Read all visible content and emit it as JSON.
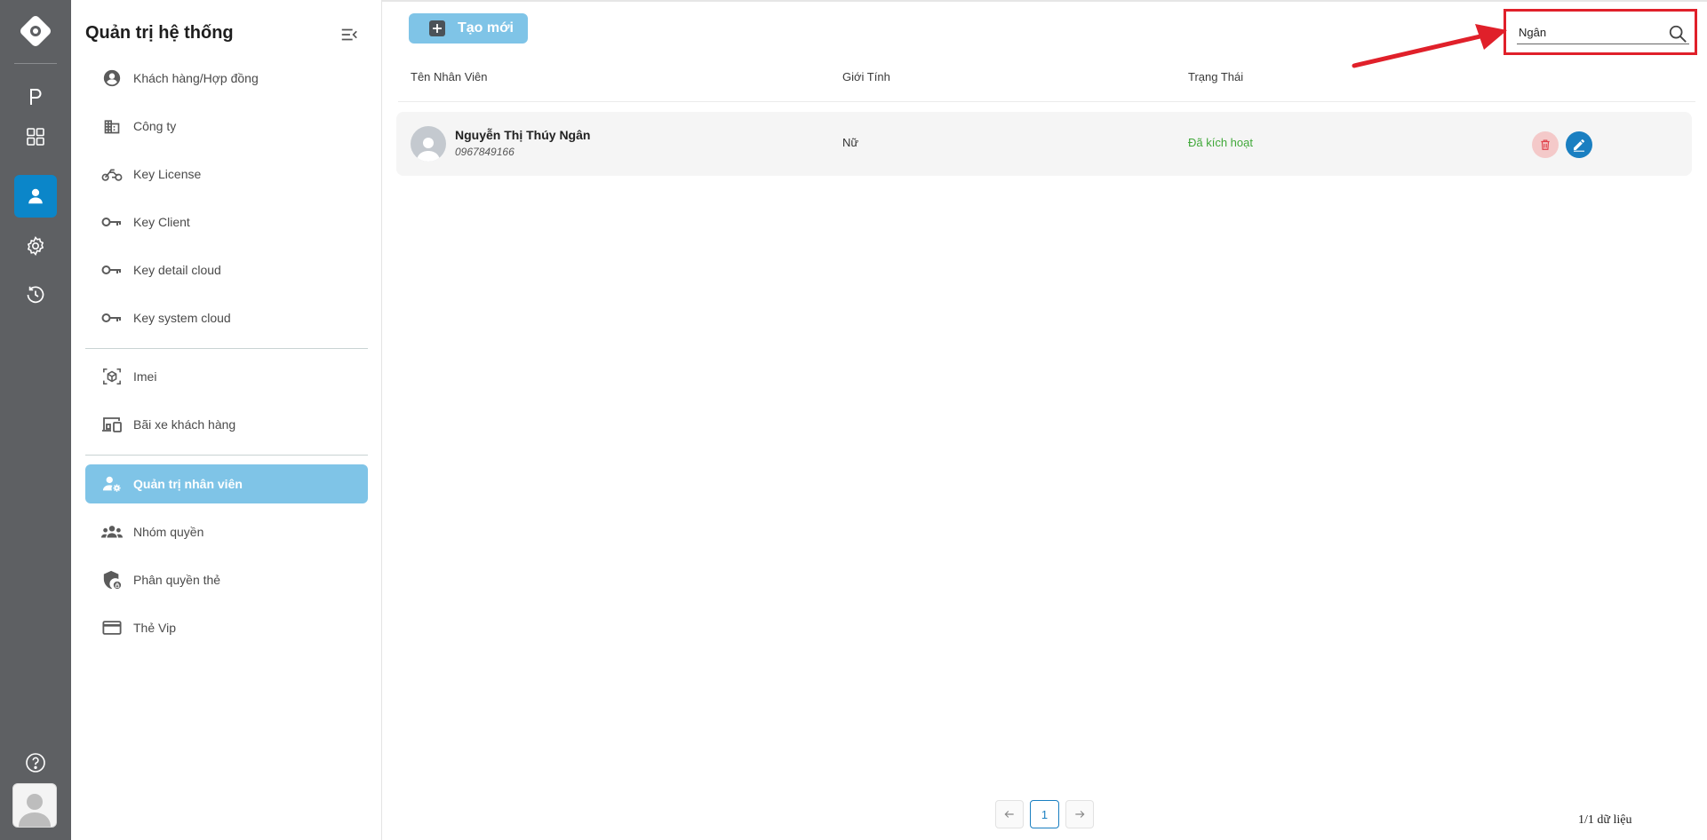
{
  "sidebar": {
    "title": "Quản trị hệ thống",
    "items": [
      {
        "label": "Khách hàng/Hợp đồng",
        "icon": "account-circle-icon"
      },
      {
        "label": "Công ty",
        "icon": "building-icon"
      },
      {
        "label": "Key License",
        "icon": "motorbike-icon"
      },
      {
        "label": "Key Client",
        "icon": "key-icon"
      },
      {
        "label": "Key detail cloud",
        "icon": "key-icon"
      },
      {
        "label": "Key system cloud",
        "icon": "key-icon"
      },
      {
        "label": "Imei",
        "icon": "cube-scan-icon"
      },
      {
        "label": "Bãi xe khách hàng",
        "icon": "devices-icon"
      },
      {
        "label": "Quản trị nhân viên",
        "icon": "user-gear-icon",
        "active": true
      },
      {
        "label": "Nhóm quyền",
        "icon": "group-icon"
      },
      {
        "label": "Phân quyền thẻ",
        "icon": "shield-lock-icon"
      },
      {
        "label": "Thẻ Vip",
        "icon": "credit-card-icon"
      }
    ]
  },
  "rail": {
    "items": [
      "logo-icon",
      "parking-icon",
      "dashboard-grid-icon",
      "user-icon",
      "settings-icon",
      "history-icon"
    ],
    "active": "user-icon"
  },
  "toolbar": {
    "create_label": "Tạo mới"
  },
  "search": {
    "value": "Ngân",
    "placeholder": ""
  },
  "table": {
    "columns": [
      "Tên Nhân Viên",
      "Giới Tính",
      "Trạng Thái"
    ],
    "rows": [
      {
        "name": "Nguyễn Thị Thúy Ngân",
        "phone": "0967849166",
        "gender": "Nữ",
        "status": "Đã kích hoạt"
      }
    ]
  },
  "pagination": {
    "current": "1",
    "summary": "1/1 dữ liệu"
  },
  "colors": {
    "rail_bg": "#5e6063",
    "accent": "#0b86c9",
    "active_menu": "#7fc4e7",
    "status_active": "#41a83a",
    "highlight": "#e0202a"
  }
}
